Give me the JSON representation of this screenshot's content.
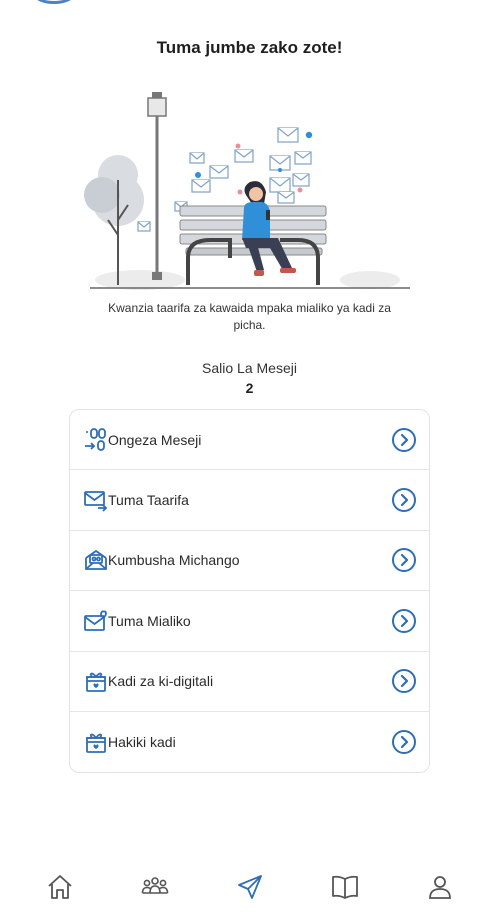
{
  "header": {
    "title": "Tuma jumbe zako zote!"
  },
  "intro": {
    "description": "Kwanzia taarifa za kawaida mpaka mialiko ya kadi za picha."
  },
  "balance": {
    "label": "Salio La Meseji",
    "value": "2"
  },
  "menu": {
    "items": [
      {
        "label": "Ongeza Meseji",
        "icon": "add-sms-icon"
      },
      {
        "label": "Tuma Taarifa",
        "icon": "send-mail-icon"
      },
      {
        "label": "Kumbusha Michango",
        "icon": "reminder-icon"
      },
      {
        "label": "Tuma Mialiko",
        "icon": "invite-mail-icon"
      },
      {
        "label": "Kadi za ki-digitali",
        "icon": "gift-card-icon"
      },
      {
        "label": "Hakiki kadi",
        "icon": "verify-card-icon"
      }
    ]
  },
  "bottom_nav": {
    "items": [
      {
        "icon": "home-icon",
        "active": false
      },
      {
        "icon": "group-icon",
        "active": false
      },
      {
        "icon": "send-icon",
        "active": true
      },
      {
        "icon": "book-icon",
        "active": false
      },
      {
        "icon": "profile-icon",
        "active": false
      }
    ]
  },
  "colors": {
    "accent": "#2f6db5",
    "nav_active": "#2f6db5",
    "nav_inactive": "#555555"
  }
}
